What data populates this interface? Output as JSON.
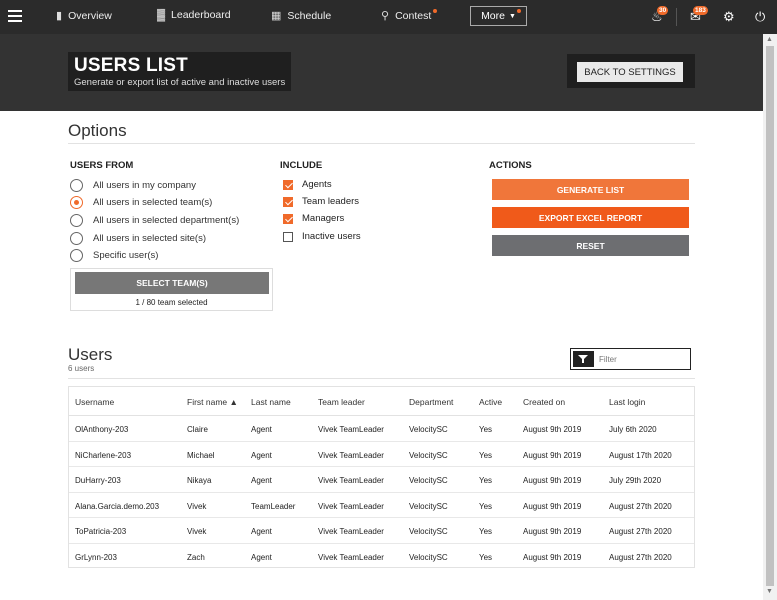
{
  "nav": {
    "items": [
      {
        "label": "Overview",
        "icon": "clipboard-icon"
      },
      {
        "label": "Leaderboard",
        "icon": "bar-chart-icon"
      },
      {
        "label": "Schedule",
        "icon": "calendar-icon"
      },
      {
        "label": "Contest",
        "icon": "trophy-icon"
      }
    ],
    "more_label": "More",
    "notifications_count": "30",
    "messages_count": "183"
  },
  "header": {
    "title": "USERS LIST",
    "subtitle": "Generate or export list of active and inactive users",
    "back_label": "BACK TO SETTINGS"
  },
  "options": {
    "title": "Options",
    "users_from": {
      "heading": "USERS FROM",
      "choices": [
        {
          "label": "All users in my company",
          "selected": false
        },
        {
          "label": "All users in selected team(s)",
          "selected": true
        },
        {
          "label": "All users in selected department(s)",
          "selected": false
        },
        {
          "label": "All users in selected site(s)",
          "selected": false
        },
        {
          "label": "Specific user(s)",
          "selected": false
        }
      ],
      "select_team_label": "SELECT TEAM(S)",
      "team_selection_text": "1 / 80 team selected"
    },
    "include": {
      "heading": "INCLUDE",
      "items": [
        {
          "label": "Agents",
          "checked": true
        },
        {
          "label": "Team leaders",
          "checked": true
        },
        {
          "label": "Managers",
          "checked": true
        },
        {
          "label": "Inactive users",
          "checked": false
        }
      ]
    },
    "actions": {
      "heading": "ACTIONS",
      "generate_label": "GENERATE LIST",
      "export_label": "EXPORT EXCEL REPORT",
      "reset_label": "RESET"
    }
  },
  "users": {
    "title": "Users",
    "count_text": "6 users",
    "filter_placeholder": "Filter",
    "columns": [
      "Username",
      "First name ▲",
      "Last name",
      "Team leader",
      "Department",
      "Active",
      "Created on",
      "Last login"
    ],
    "rows": [
      [
        "OlAnthony-203",
        "Claire",
        "Agent",
        "Vivek TeamLeader",
        "VelocitySC",
        "Yes",
        "August 9th 2019",
        "July 6th 2020"
      ],
      [
        "NiCharlene-203",
        "Michael",
        "Agent",
        "Vivek TeamLeader",
        "VelocitySC",
        "Yes",
        "August 9th 2019",
        "August 17th 2020"
      ],
      [
        "DuHarry-203",
        "Nikaya",
        "Agent",
        "Vivek TeamLeader",
        "VelocitySC",
        "Yes",
        "August 9th 2019",
        "July 29th 2020"
      ],
      [
        "Alana.Garcia.demo.203",
        "Vivek",
        "TeamLeader",
        "Vivek TeamLeader",
        "VelocitySC",
        "Yes",
        "August 9th 2019",
        "August 27th 2020"
      ],
      [
        "ToPatricia-203",
        "Vivek",
        "Agent",
        "Vivek TeamLeader",
        "VelocitySC",
        "Yes",
        "August 9th 2019",
        "August 27th 2020"
      ],
      [
        "GrLynn-203",
        "Zach",
        "Agent",
        "Vivek TeamLeader",
        "VelocitySC",
        "Yes",
        "August 9th 2019",
        "August 27th 2020"
      ]
    ]
  },
  "colors": {
    "accent": "#f06a2a",
    "export": "#f05a1a",
    "reset": "#6d6e71",
    "nav_bg": "#2b2b2b",
    "band_bg": "#333333"
  }
}
